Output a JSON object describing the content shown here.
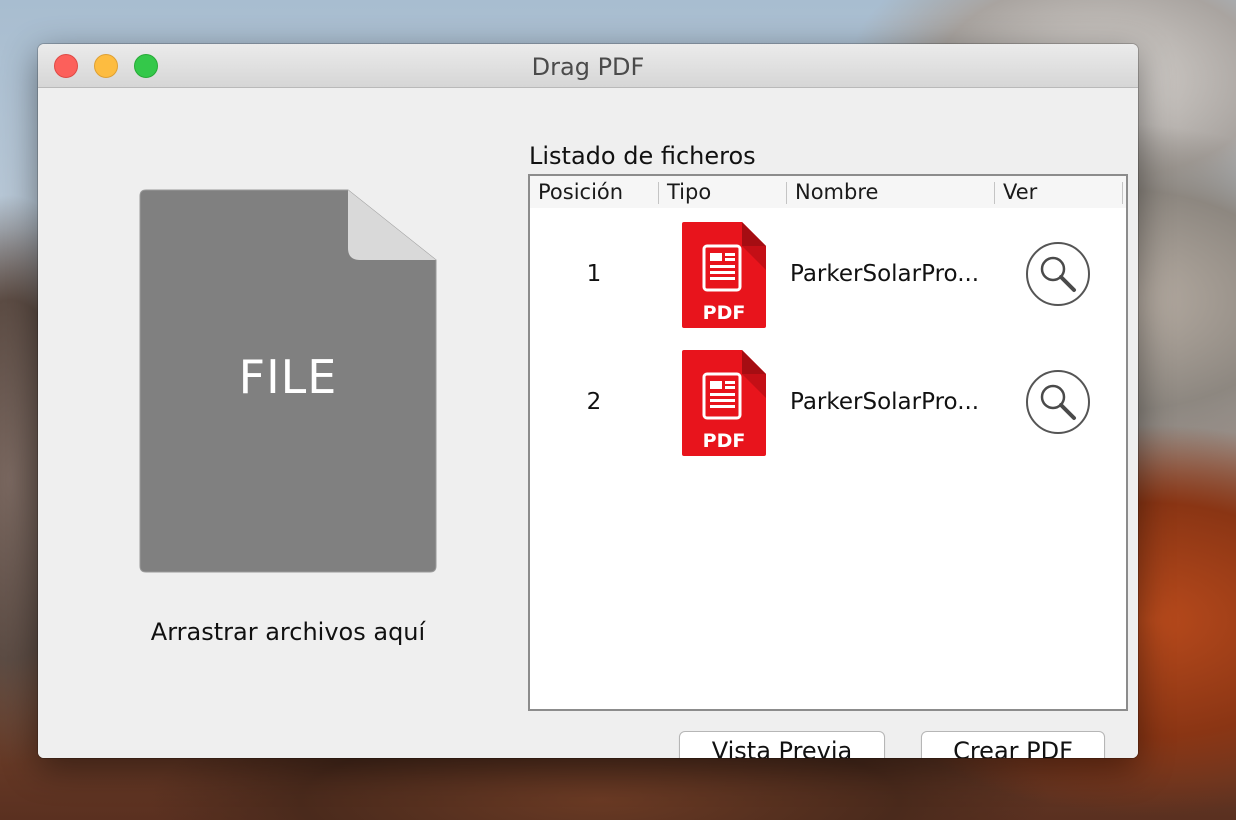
{
  "window": {
    "title": "Drag PDF"
  },
  "dropzone": {
    "file_label": "FILE",
    "instruction": "Arrastrar archivos aquí"
  },
  "file_list": {
    "label": "Listado de ficheros",
    "columns": [
      "Posición",
      "Tipo",
      "Nombre",
      "Ver"
    ],
    "rows": [
      {
        "position": "1",
        "type_icon": "pdf-file-icon",
        "name": "ParkerSolarPro...",
        "view_icon": "magnifier-icon"
      },
      {
        "position": "2",
        "type_icon": "pdf-file-icon",
        "name": "ParkerSolarPro...",
        "view_icon": "magnifier-icon"
      }
    ]
  },
  "buttons": {
    "preview": "Vista Previa",
    "create": "Crear PDF"
  },
  "colors": {
    "pdf_red": "#e8141c",
    "file_gray": "#808080"
  }
}
